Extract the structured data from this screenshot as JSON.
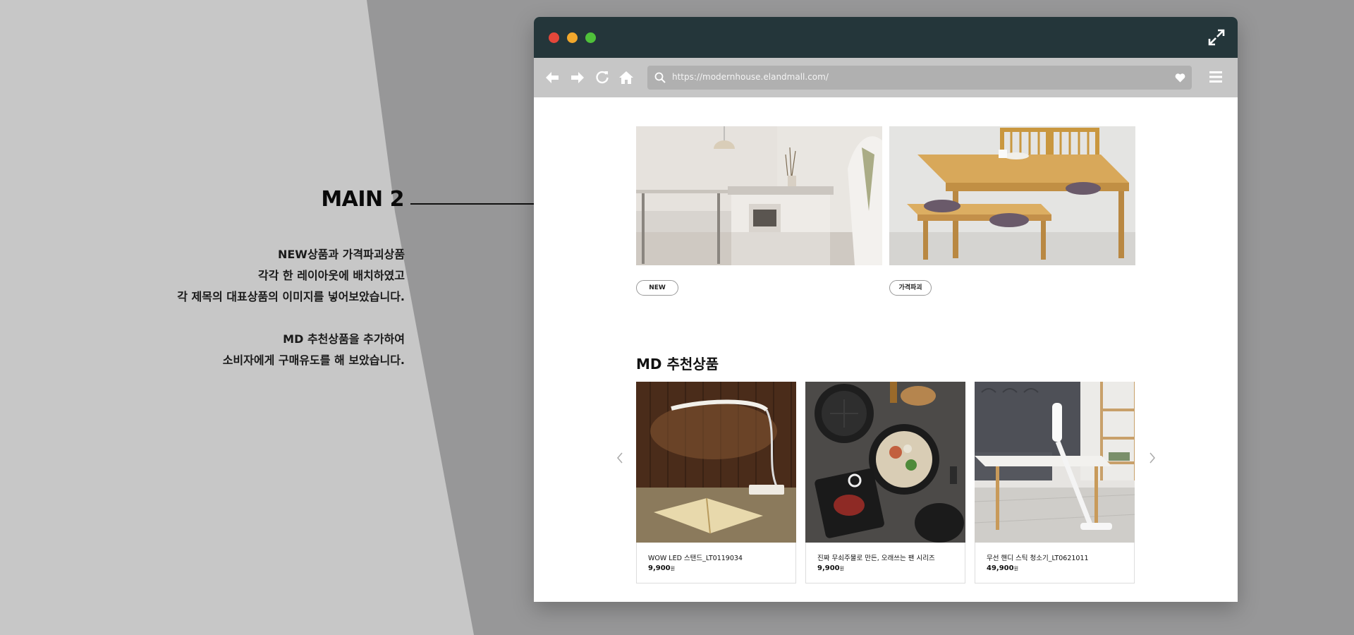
{
  "annotation": {
    "title": "MAIN 2",
    "description_lines": [
      "NEW상품과 가격파괴상품",
      "각각 한 레이아웃에 배치하였고",
      "각 제목의 대표상품의 이미지를 넣어보았습니다."
    ],
    "description2_lines": [
      "MD 추천상품을 추가하여",
      "소비자에게 구매유도를 해 보았습니다."
    ]
  },
  "browser": {
    "url": "https://modernhouse.elandmall.com/",
    "window_controls": [
      "close",
      "minimize",
      "maximize"
    ],
    "nav_icons": [
      "back-icon",
      "forward-icon",
      "reload-icon",
      "home-icon"
    ],
    "url_icons": [
      "search-icon",
      "heart-icon"
    ],
    "menu_icon": "hamburger-menu-icon",
    "colors": {
      "titlebar": "#24363a",
      "toolbar": "#c6c6c6",
      "close": "#e5473a",
      "minimize": "#f2a82c",
      "maximize": "#4fc13a"
    }
  },
  "banners": [
    {
      "tag": "NEW",
      "image": "kitchen-island-photo"
    },
    {
      "tag": "가격파괴",
      "image": "wooden-dining-table-photo"
    }
  ],
  "md": {
    "title": "MD 추천상품",
    "products": [
      {
        "name": "WOW LED 스탠드_LT0119034",
        "price": "9,900",
        "currency": "원",
        "image": "led-desk-lamp-photo"
      },
      {
        "name": "진짜 무쇠주물로 만든, 오래쓰는 팬 시리즈",
        "price": "9,900",
        "currency": "원",
        "image": "cast-iron-pans-photo"
      },
      {
        "name": "무선 핸디 스틱 청소기_LT0621011",
        "price": "49,900",
        "currency": "원",
        "image": "cordless-stick-vacuum-photo"
      }
    ],
    "prev_icon": "chevron-left-icon",
    "next_icon": "chevron-right-icon"
  }
}
